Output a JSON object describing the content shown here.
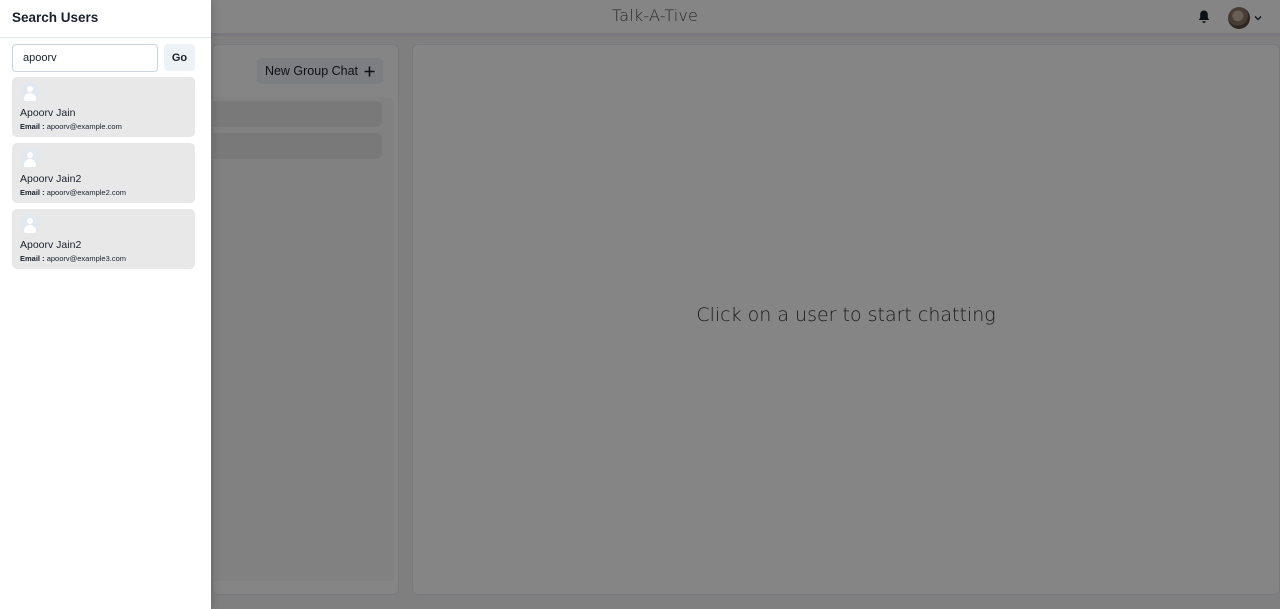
{
  "app": {
    "title": "Talk-A-Tive",
    "new_group_chat_label": "New Group Chat",
    "empty_chat_message": "Click on a user to start chatting"
  },
  "drawer": {
    "title": "Search Users",
    "search_value": "apoorv",
    "go_label": "Go",
    "email_label": "Email :",
    "results": [
      {
        "name": "Apoorv Jain",
        "email": "apoorv@example.com"
      },
      {
        "name": "Apoorv Jain2",
        "email": "apoorv@example2.com"
      },
      {
        "name": "Apoorv Jain2",
        "email": "apoorv@example3.com"
      }
    ]
  },
  "icons": {
    "notification": "bell-icon",
    "profile": "avatar",
    "menu": "chevron-down-icon",
    "add": "plus-icon",
    "user_placeholder": "user-avatar-icon"
  },
  "colors": {
    "overlay": "rgba(0,0,0,0.48)",
    "result_card": "#e8e8e8",
    "button_bg": "#edf2f7"
  }
}
